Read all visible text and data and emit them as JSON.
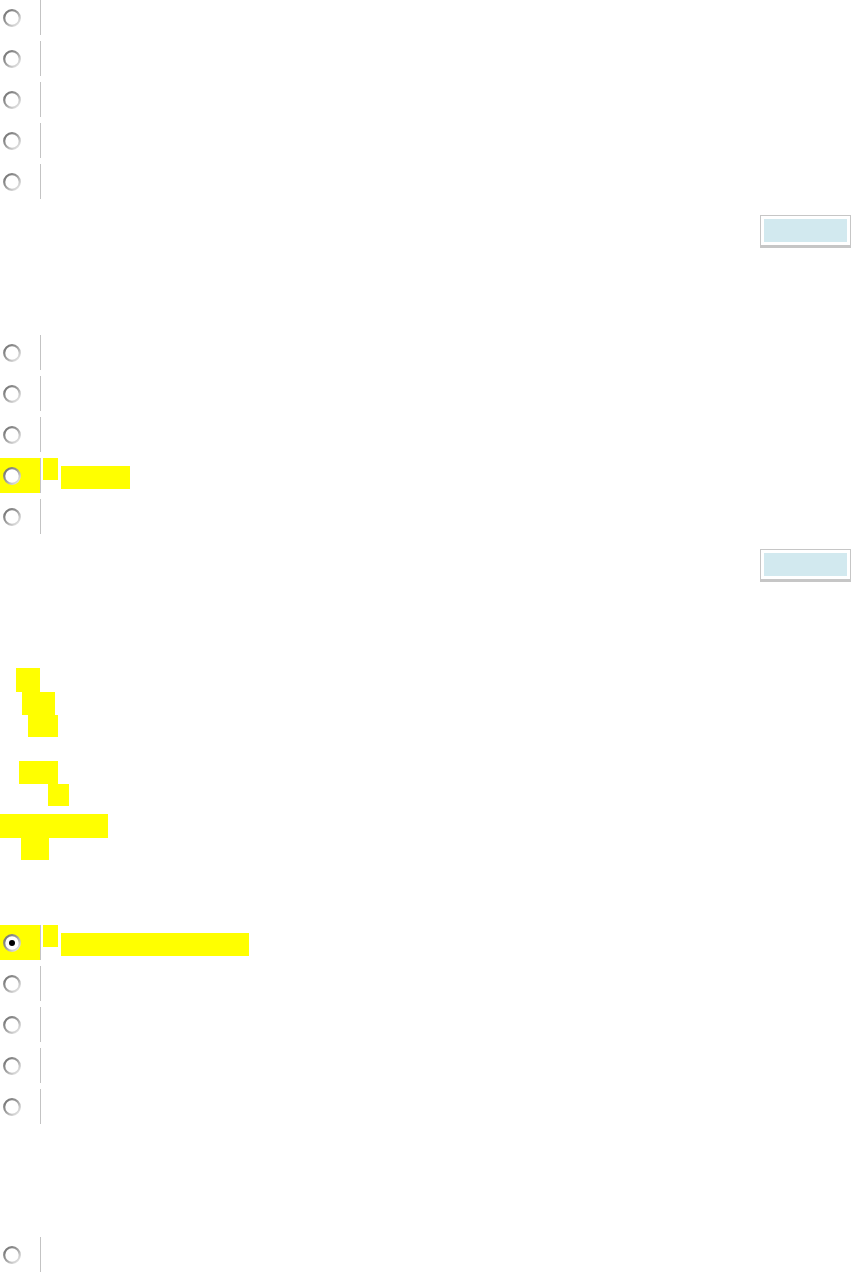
{
  "sections": [
    {
      "kind": "radio_group",
      "options": [
        {
          "selected": false,
          "highlighted": false
        },
        {
          "selected": false,
          "highlighted": false
        },
        {
          "selected": false,
          "highlighted": false
        },
        {
          "selected": false,
          "highlighted": false
        },
        {
          "selected": false,
          "highlighted": false
        }
      ]
    },
    {
      "kind": "button"
    },
    {
      "kind": "radio_group",
      "options": [
        {
          "selected": false,
          "highlighted": false
        },
        {
          "selected": false,
          "highlighted": false
        },
        {
          "selected": false,
          "highlighted": false
        },
        {
          "selected": false,
          "highlighted": true
        },
        {
          "selected": false,
          "highlighted": false
        }
      ]
    },
    {
      "kind": "button"
    },
    {
      "kind": "highlighted_text",
      "lines": [
        {
          "highlighted": true
        },
        {
          "highlighted": true
        },
        {
          "highlighted": true
        },
        {
          "highlighted": true
        },
        {
          "highlighted": true
        },
        {
          "highlighted": true
        },
        {
          "highlighted": true
        }
      ]
    },
    {
      "kind": "radio_group",
      "options": [
        {
          "selected": true,
          "highlighted": true
        },
        {
          "selected": false,
          "highlighted": false
        },
        {
          "selected": false,
          "highlighted": false
        },
        {
          "selected": false,
          "highlighted": false
        },
        {
          "selected": false,
          "highlighted": false
        }
      ]
    },
    {
      "kind": "radio_group",
      "options": [
        {
          "selected": false,
          "highlighted": false
        }
      ]
    }
  ]
}
